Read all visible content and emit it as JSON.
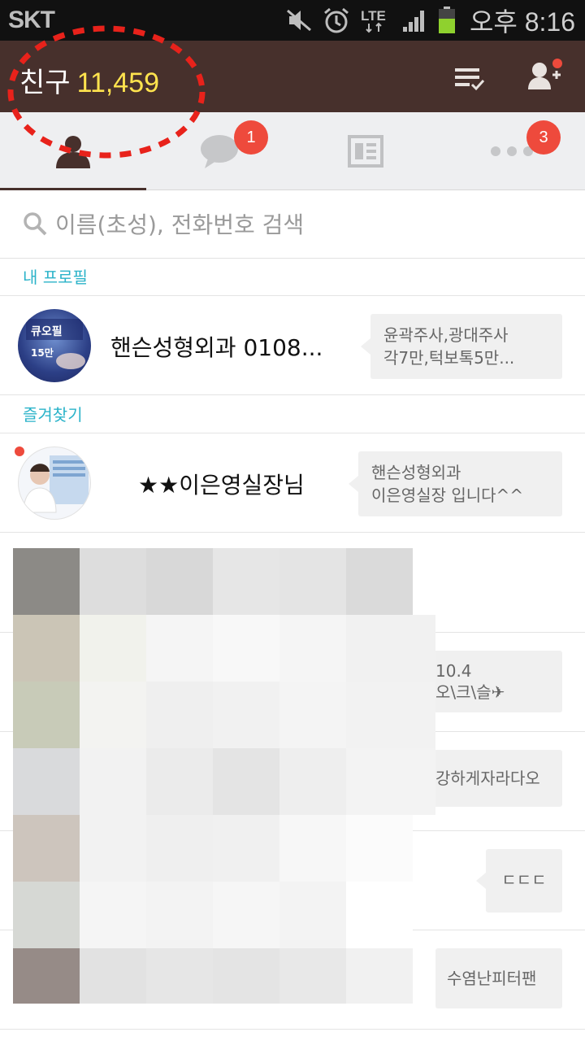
{
  "status_bar": {
    "carrier": "SKT",
    "network": "LTE",
    "time": "오후 8:16",
    "icons": [
      "mute-icon",
      "alarm-icon",
      "lte-icon",
      "signal-icon",
      "battery-icon"
    ]
  },
  "header": {
    "title": "친구",
    "count": "11,459",
    "buttons": [
      "edit-list-icon",
      "add-friend-icon"
    ]
  },
  "tabs": [
    {
      "name": "friends",
      "icon": "person-icon",
      "badge": ""
    },
    {
      "name": "chats",
      "icon": "chat-bubble-icon",
      "badge": "1"
    },
    {
      "name": "channel",
      "icon": "news-icon",
      "badge": ""
    },
    {
      "name": "more",
      "icon": "more-dots-icon",
      "badge": "3"
    }
  ],
  "search": {
    "placeholder": "이름(초성), 전화번호 검색"
  },
  "sections": {
    "my_profile": "내 프로필",
    "favorites": "즐겨찾기"
  },
  "my_profile": {
    "name": "핸슨성형외과 0108...",
    "avatar_text_1": "큐오필",
    "avatar_text_2": "15만",
    "status_line1": "윤곽주사,광대주사",
    "status_line2": "각7만,턱보톡5만..."
  },
  "favorite": {
    "name": "★★이은영실장님",
    "status_line1": "핸슨성형외과",
    "status_line2": "이은영실장 입니다^^"
  },
  "partial_messages": {
    "msg1_line1": "10.4",
    "msg1_line2": "오\\크\\슬✈",
    "msg2": "강하게자라다오",
    "msg3": "ㄷㄷㄷ",
    "msg4": "수염난피터팬"
  },
  "colors": {
    "header_bg": "#47302c",
    "count": "#ffe34e",
    "badge": "#ee4a3c",
    "section_text": "#2bb3c9"
  }
}
